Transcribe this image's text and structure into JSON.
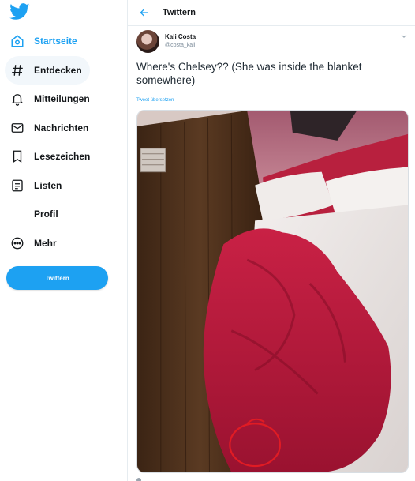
{
  "sidebar": {
    "logo_icon": "twitter-bird-icon",
    "items": [
      {
        "label": "Startseite",
        "icon": "home-icon",
        "active": true
      },
      {
        "label": "Entdecken",
        "icon": "hashtag-icon"
      },
      {
        "label": "Mitteilungen",
        "icon": "bell-icon"
      },
      {
        "label": "Nachrichten",
        "icon": "envelope-icon"
      },
      {
        "label": "Lesezeichen",
        "icon": "bookmark-icon"
      },
      {
        "label": "Listen",
        "icon": "list-icon"
      },
      {
        "label": "Profil",
        "icon": ""
      },
      {
        "label": "Mehr",
        "icon": "more-circle-icon"
      }
    ],
    "tweet_button": "Twittern"
  },
  "header": {
    "title": "Twittern",
    "back_icon": "back-arrow-icon"
  },
  "tweet": {
    "author_name": "Kali Costa",
    "author_handle": "@costa_kali",
    "text": "Where's Chelsey?? (She was inside the blanket somewhere)",
    "translate_link": "Tweet übersetzen"
  },
  "colors": {
    "accent": "#1da1f2",
    "blanket": "#c1213f",
    "annotation_circle": "#e01b24"
  }
}
